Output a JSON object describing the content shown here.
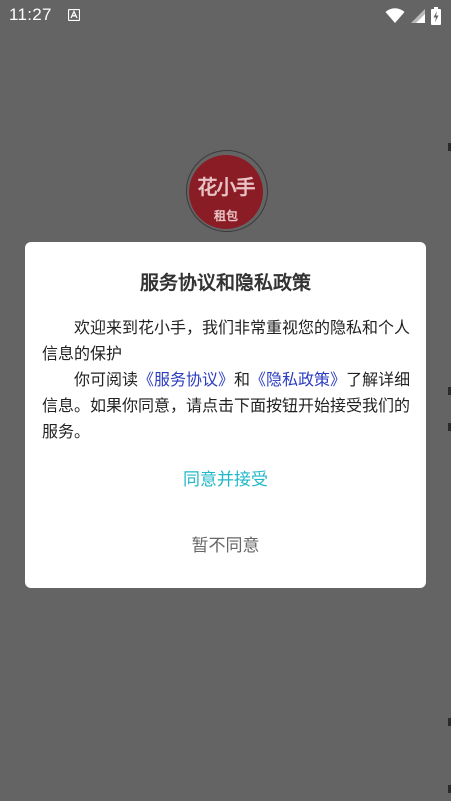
{
  "status_bar": {
    "time": "11:27",
    "notification_icon": "a-letter-icon",
    "wifi_icon": "wifi-icon",
    "signal_icon": "signal-icon",
    "battery_icon": "battery-charging-icon"
  },
  "background": {
    "logo": {
      "main_text": "花小手",
      "sub_text": "租包"
    }
  },
  "dialog": {
    "title": "服务协议和隐私政策",
    "paragraph1": "欢迎来到花小手，我们非常重视您的隐私和个人信息的保护",
    "paragraph2_prefix": "你可阅读",
    "service_agreement_link": "《服务协议》",
    "paragraph2_and": "和",
    "privacy_policy_link": "《隐私政策》",
    "paragraph2_suffix": "了解详细信息。如果你同意，请点击下面按钮开始接受我们的服务。",
    "agree_label": "同意并接受",
    "disagree_label": "暂不同意"
  },
  "colors": {
    "overlay": "#646464",
    "dialog_background": "#ffffff",
    "agree": "#20b8c9",
    "link": "#2a3cc0",
    "logo": "#8a1c25"
  }
}
